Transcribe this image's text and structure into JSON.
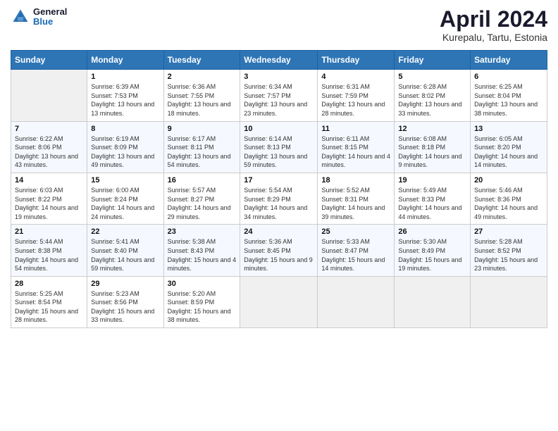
{
  "header": {
    "logo_general": "General",
    "logo_blue": "Blue",
    "title": "April 2024",
    "subtitle": "Kurepalu, Tartu, Estonia"
  },
  "calendar": {
    "days_of_week": [
      "Sunday",
      "Monday",
      "Tuesday",
      "Wednesday",
      "Thursday",
      "Friday",
      "Saturday"
    ],
    "weeks": [
      [
        {
          "day": "",
          "sunrise": "",
          "sunset": "",
          "daylight": "",
          "empty": true
        },
        {
          "day": "1",
          "sunrise": "Sunrise: 6:39 AM",
          "sunset": "Sunset: 7:53 PM",
          "daylight": "Daylight: 13 hours and 13 minutes."
        },
        {
          "day": "2",
          "sunrise": "Sunrise: 6:36 AM",
          "sunset": "Sunset: 7:55 PM",
          "daylight": "Daylight: 13 hours and 18 minutes."
        },
        {
          "day": "3",
          "sunrise": "Sunrise: 6:34 AM",
          "sunset": "Sunset: 7:57 PM",
          "daylight": "Daylight: 13 hours and 23 minutes."
        },
        {
          "day": "4",
          "sunrise": "Sunrise: 6:31 AM",
          "sunset": "Sunset: 7:59 PM",
          "daylight": "Daylight: 13 hours and 28 minutes."
        },
        {
          "day": "5",
          "sunrise": "Sunrise: 6:28 AM",
          "sunset": "Sunset: 8:02 PM",
          "daylight": "Daylight: 13 hours and 33 minutes."
        },
        {
          "day": "6",
          "sunrise": "Sunrise: 6:25 AM",
          "sunset": "Sunset: 8:04 PM",
          "daylight": "Daylight: 13 hours and 38 minutes."
        }
      ],
      [
        {
          "day": "7",
          "sunrise": "Sunrise: 6:22 AM",
          "sunset": "Sunset: 8:06 PM",
          "daylight": "Daylight: 13 hours and 43 minutes."
        },
        {
          "day": "8",
          "sunrise": "Sunrise: 6:19 AM",
          "sunset": "Sunset: 8:09 PM",
          "daylight": "Daylight: 13 hours and 49 minutes."
        },
        {
          "day": "9",
          "sunrise": "Sunrise: 6:17 AM",
          "sunset": "Sunset: 8:11 PM",
          "daylight": "Daylight: 13 hours and 54 minutes."
        },
        {
          "day": "10",
          "sunrise": "Sunrise: 6:14 AM",
          "sunset": "Sunset: 8:13 PM",
          "daylight": "Daylight: 13 hours and 59 minutes."
        },
        {
          "day": "11",
          "sunrise": "Sunrise: 6:11 AM",
          "sunset": "Sunset: 8:15 PM",
          "daylight": "Daylight: 14 hours and 4 minutes."
        },
        {
          "day": "12",
          "sunrise": "Sunrise: 6:08 AM",
          "sunset": "Sunset: 8:18 PM",
          "daylight": "Daylight: 14 hours and 9 minutes."
        },
        {
          "day": "13",
          "sunrise": "Sunrise: 6:05 AM",
          "sunset": "Sunset: 8:20 PM",
          "daylight": "Daylight: 14 hours and 14 minutes."
        }
      ],
      [
        {
          "day": "14",
          "sunrise": "Sunrise: 6:03 AM",
          "sunset": "Sunset: 8:22 PM",
          "daylight": "Daylight: 14 hours and 19 minutes."
        },
        {
          "day": "15",
          "sunrise": "Sunrise: 6:00 AM",
          "sunset": "Sunset: 8:24 PM",
          "daylight": "Daylight: 14 hours and 24 minutes."
        },
        {
          "day": "16",
          "sunrise": "Sunrise: 5:57 AM",
          "sunset": "Sunset: 8:27 PM",
          "daylight": "Daylight: 14 hours and 29 minutes."
        },
        {
          "day": "17",
          "sunrise": "Sunrise: 5:54 AM",
          "sunset": "Sunset: 8:29 PM",
          "daylight": "Daylight: 14 hours and 34 minutes."
        },
        {
          "day": "18",
          "sunrise": "Sunrise: 5:52 AM",
          "sunset": "Sunset: 8:31 PM",
          "daylight": "Daylight: 14 hours and 39 minutes."
        },
        {
          "day": "19",
          "sunrise": "Sunrise: 5:49 AM",
          "sunset": "Sunset: 8:33 PM",
          "daylight": "Daylight: 14 hours and 44 minutes."
        },
        {
          "day": "20",
          "sunrise": "Sunrise: 5:46 AM",
          "sunset": "Sunset: 8:36 PM",
          "daylight": "Daylight: 14 hours and 49 minutes."
        }
      ],
      [
        {
          "day": "21",
          "sunrise": "Sunrise: 5:44 AM",
          "sunset": "Sunset: 8:38 PM",
          "daylight": "Daylight: 14 hours and 54 minutes."
        },
        {
          "day": "22",
          "sunrise": "Sunrise: 5:41 AM",
          "sunset": "Sunset: 8:40 PM",
          "daylight": "Daylight: 14 hours and 59 minutes."
        },
        {
          "day": "23",
          "sunrise": "Sunrise: 5:38 AM",
          "sunset": "Sunset: 8:43 PM",
          "daylight": "Daylight: 15 hours and 4 minutes."
        },
        {
          "day": "24",
          "sunrise": "Sunrise: 5:36 AM",
          "sunset": "Sunset: 8:45 PM",
          "daylight": "Daylight: 15 hours and 9 minutes."
        },
        {
          "day": "25",
          "sunrise": "Sunrise: 5:33 AM",
          "sunset": "Sunset: 8:47 PM",
          "daylight": "Daylight: 15 hours and 14 minutes."
        },
        {
          "day": "26",
          "sunrise": "Sunrise: 5:30 AM",
          "sunset": "Sunset: 8:49 PM",
          "daylight": "Daylight: 15 hours and 19 minutes."
        },
        {
          "day": "27",
          "sunrise": "Sunrise: 5:28 AM",
          "sunset": "Sunset: 8:52 PM",
          "daylight": "Daylight: 15 hours and 23 minutes."
        }
      ],
      [
        {
          "day": "28",
          "sunrise": "Sunrise: 5:25 AM",
          "sunset": "Sunset: 8:54 PM",
          "daylight": "Daylight: 15 hours and 28 minutes."
        },
        {
          "day": "29",
          "sunrise": "Sunrise: 5:23 AM",
          "sunset": "Sunset: 8:56 PM",
          "daylight": "Daylight: 15 hours and 33 minutes."
        },
        {
          "day": "30",
          "sunrise": "Sunrise: 5:20 AM",
          "sunset": "Sunset: 8:59 PM",
          "daylight": "Daylight: 15 hours and 38 minutes."
        },
        {
          "day": "",
          "sunrise": "",
          "sunset": "",
          "daylight": "",
          "empty": true
        },
        {
          "day": "",
          "sunrise": "",
          "sunset": "",
          "daylight": "",
          "empty": true
        },
        {
          "day": "",
          "sunrise": "",
          "sunset": "",
          "daylight": "",
          "empty": true
        },
        {
          "day": "",
          "sunrise": "",
          "sunset": "",
          "daylight": "",
          "empty": true
        }
      ]
    ]
  }
}
